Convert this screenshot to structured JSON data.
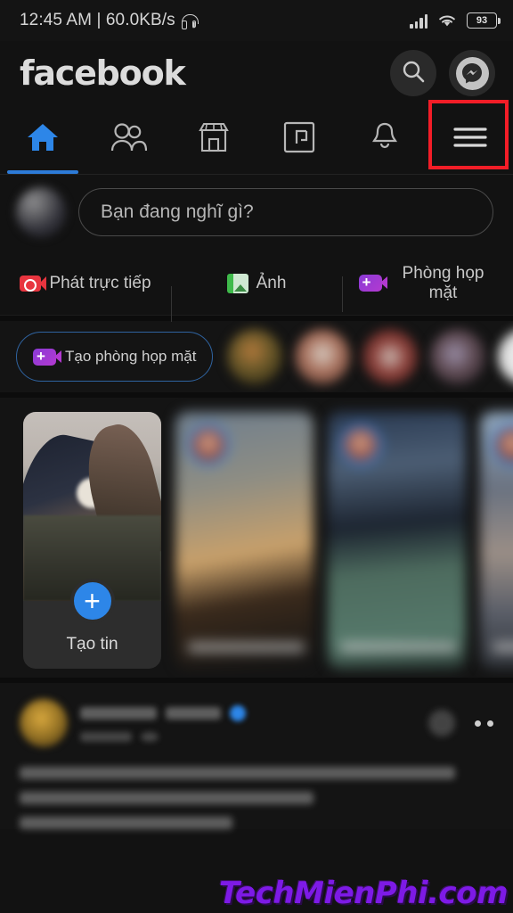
{
  "status_bar": {
    "time_and_speed": "12:45 AM | 60.0KB/s",
    "headphone_icon": "headphone-icon",
    "signal_icon": "signal-bars-icon",
    "wifi_icon": "wifi-icon",
    "battery_level": "93"
  },
  "header": {
    "logo_text": "facebook",
    "search_icon": "search-icon",
    "messenger_icon": "messenger-icon"
  },
  "tabs": [
    {
      "name": "home",
      "icon": "home-icon",
      "active": true
    },
    {
      "name": "friends",
      "icon": "friends-icon",
      "active": false
    },
    {
      "name": "marketplace",
      "icon": "marketplace-icon",
      "active": false
    },
    {
      "name": "gaming",
      "icon": "gaming-icon",
      "active": false
    },
    {
      "name": "notifications",
      "icon": "bell-icon",
      "active": false
    },
    {
      "name": "menu",
      "icon": "hamburger-menu-icon",
      "active": false,
      "highlighted": true
    }
  ],
  "highlight": {
    "color": "#f21d27",
    "target": "menu-tab"
  },
  "composer": {
    "placeholder": "Bạn đang nghĩ gì?",
    "avatar": "user-avatar"
  },
  "quick_actions": [
    {
      "label": "Phát trực tiếp",
      "icon": "live-video-icon",
      "color": "#e8353f"
    },
    {
      "label": "Ảnh",
      "icon": "photo-icon",
      "color": "#3fba4b"
    },
    {
      "label": "Phòng họp mặt",
      "icon": "room-video-icon",
      "color": "#b33ad0"
    }
  ],
  "rooms": {
    "create_label": "Tạo phòng họp mặt",
    "create_icon": "room-video-icon",
    "avatar_count": 5
  },
  "stories": {
    "create_label": "Tạo tin",
    "plus_icon": "plus-icon",
    "blurred_count": 3
  },
  "post": {
    "verified_badge": "verified-badge-icon",
    "menu_icon": "more-options-icon",
    "reaction_icon": "reaction-icon"
  },
  "watermark": {
    "text": "TechMienPhi.com",
    "color": "#7d1ae6"
  }
}
